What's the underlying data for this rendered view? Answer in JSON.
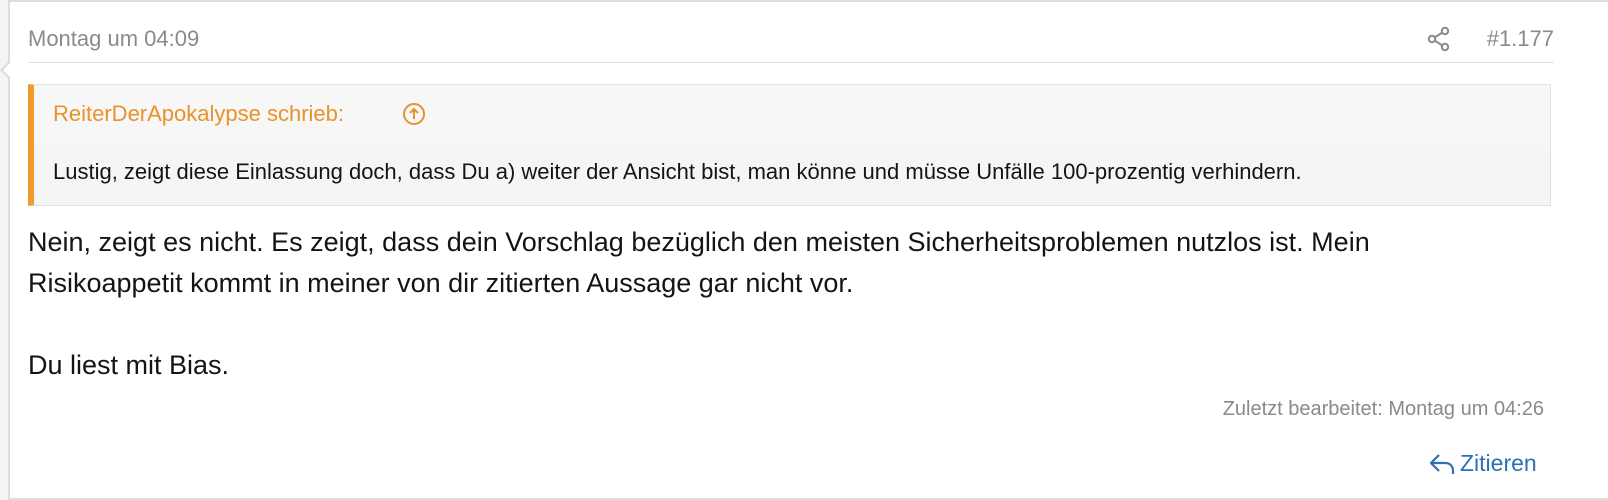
{
  "post": {
    "date": "Montag um 04:09",
    "number": "#1.177",
    "quote": {
      "author_line": "ReiterDerApokalypse schrieb:",
      "text": "Lustig, zeigt diese Einlassung doch, dass Du a) weiter der Ansicht bist, man könne und müsse Unfälle 100-prozentig verhindern."
    },
    "message": {
      "line1": "Nein, zeigt es nicht. Es zeigt, dass dein Vorschlag bezüglich den meisten Sicherheitsproblemen nutzlos ist. Mein",
      "line2": "Risikoappetit kommt in meiner von dir zitierten Aussage gar nicht vor.",
      "line3": "Du liest mit Bias."
    },
    "edited": "Zuletzt bearbeitet: Montag um 04:26",
    "reply_label": "Zitieren"
  },
  "colors": {
    "accent": "#f29a2e",
    "quote_author": "#e8922a",
    "link": "#2f6fb3",
    "muted": "#8a8a8a"
  },
  "icons": {
    "share": "share-icon",
    "quote_jump": "arrow-up-circle-icon",
    "reply": "reply-arrow-icon"
  }
}
